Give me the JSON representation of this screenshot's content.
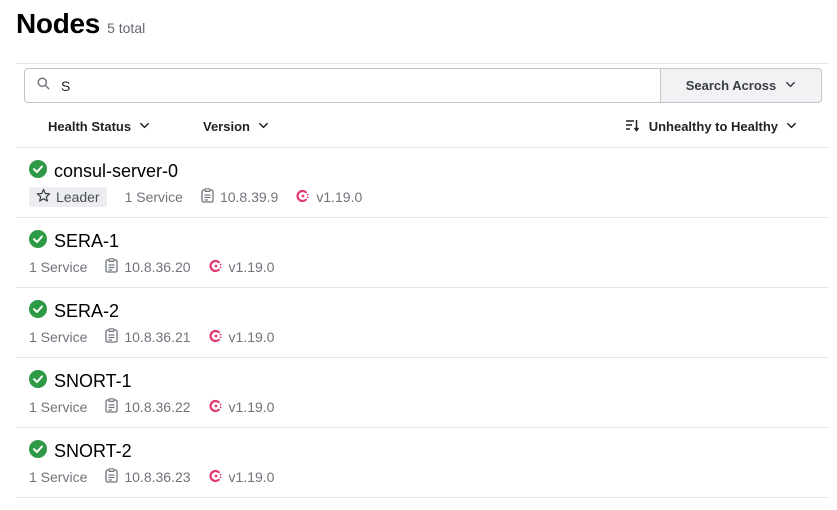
{
  "header": {
    "title": "Nodes",
    "count": "5 total"
  },
  "search": {
    "value": "S",
    "placeholder": "",
    "across_label": "Search Across"
  },
  "filters": {
    "health": "Health Status",
    "version": "Version",
    "sort": "Unhealthy to Healthy"
  },
  "colors": {
    "healthy": "#2e9a45",
    "consul": "#e03875",
    "border": "#e4e6ea",
    "muted": "#6f737a"
  },
  "nodes": [
    {
      "name": "consul-server-0",
      "leader": "Leader",
      "services": "1 Service",
      "address": "10.8.39.9",
      "version": "v1.19.0"
    },
    {
      "name": "SERA-1",
      "services": "1 Service",
      "address": "10.8.36.20",
      "version": "v1.19.0"
    },
    {
      "name": "SERA-2",
      "services": "1 Service",
      "address": "10.8.36.21",
      "version": "v1.19.0"
    },
    {
      "name": "SNORT-1",
      "services": "1 Service",
      "address": "10.8.36.22",
      "version": "v1.19.0"
    },
    {
      "name": "SNORT-2",
      "services": "1 Service",
      "address": "10.8.36.23",
      "version": "v1.19.0"
    }
  ]
}
